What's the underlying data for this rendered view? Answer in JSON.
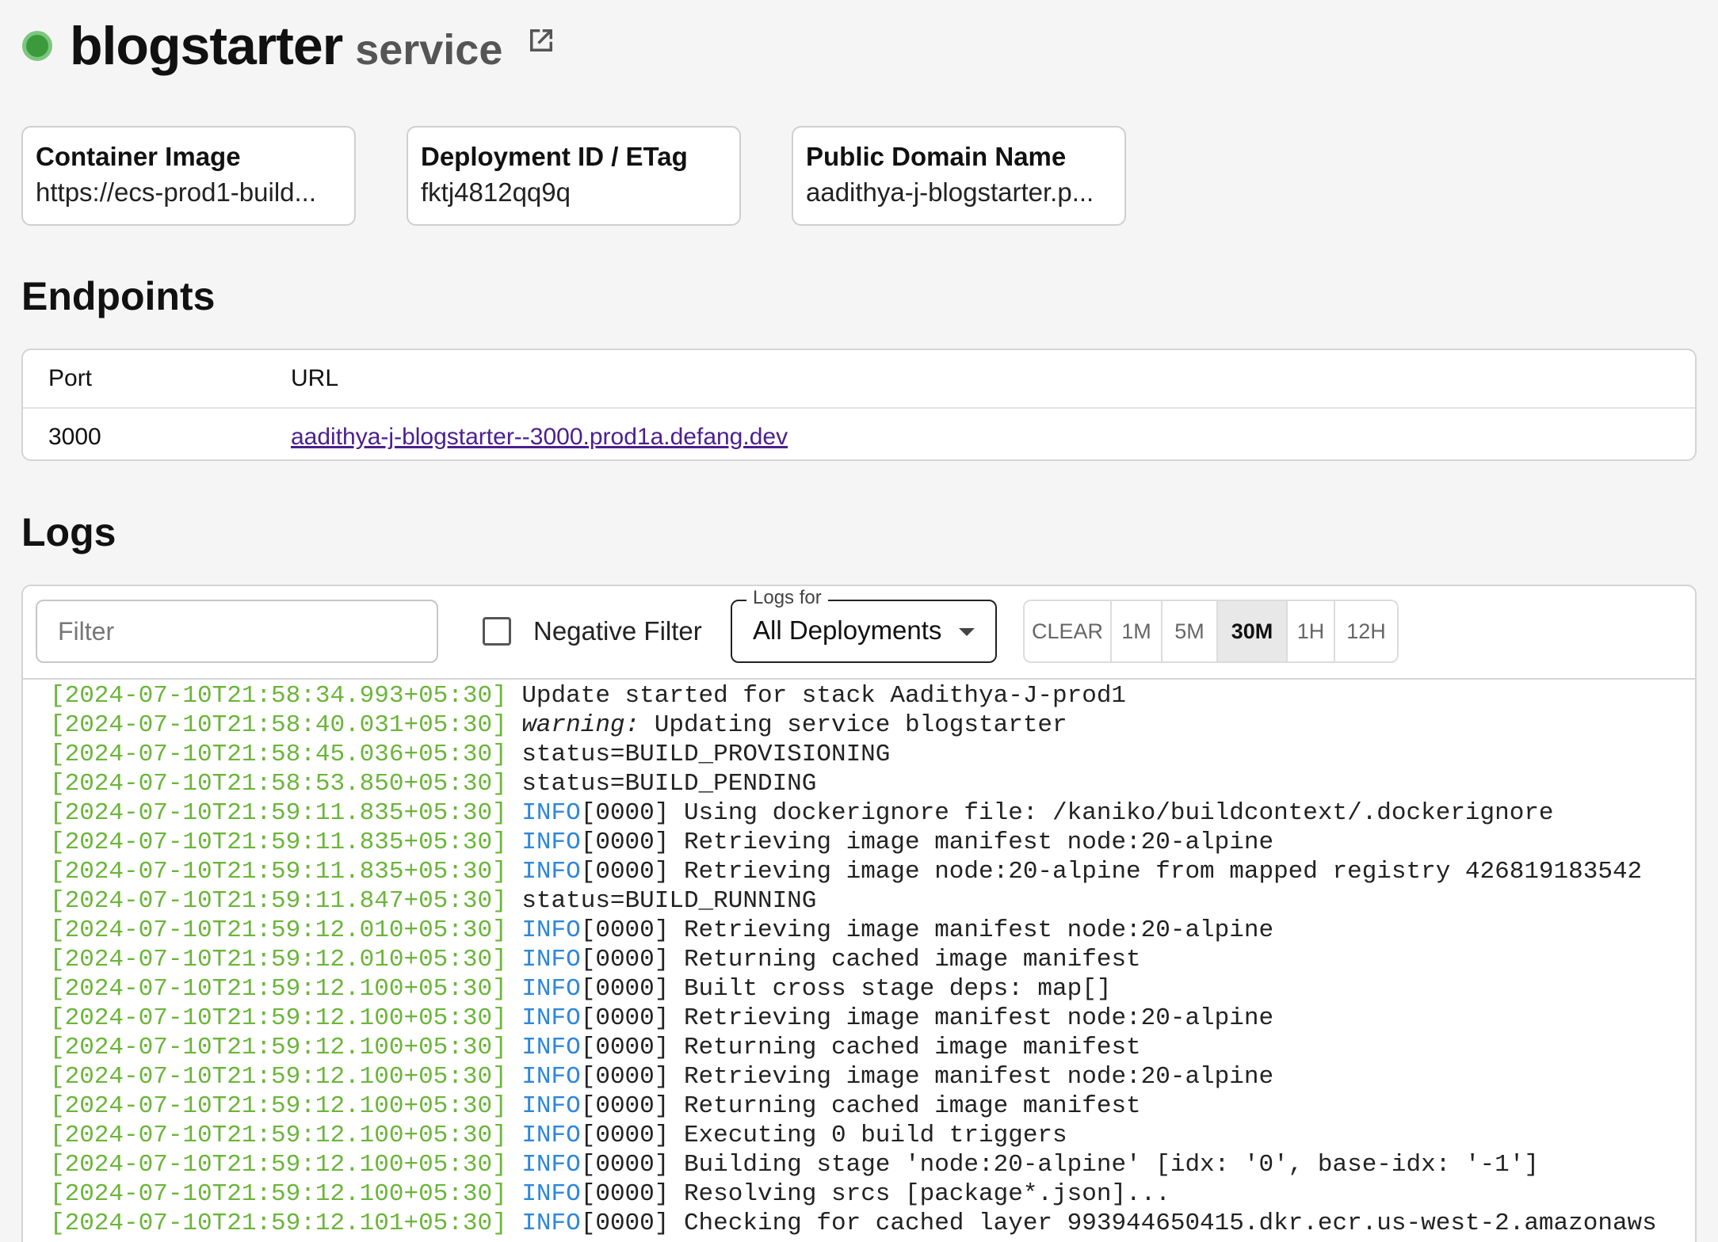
{
  "header": {
    "service_name": "blogstarter",
    "service_suffix": "service",
    "status_color": "#3a9a3c"
  },
  "cards": [
    {
      "title": "Container Image",
      "value": "https://ecs-prod1-build..."
    },
    {
      "title": "Deployment ID / ETag",
      "value": "fktj4812qq9q"
    },
    {
      "title": "Public Domain Name",
      "value": "aadithya-j-blogstarter.p..."
    }
  ],
  "endpoints": {
    "title": "Endpoints",
    "col_port": "Port",
    "col_url": "URL",
    "rows": [
      {
        "port": "3000",
        "url": "aadithya-j-blogstarter--3000.prod1a.defang.dev"
      }
    ]
  },
  "logs": {
    "title": "Logs",
    "filter_placeholder": "Filter",
    "negative_filter_label": "Negative Filter",
    "logs_for_label": "Logs for",
    "logs_for_value": "All Deployments",
    "ranges": [
      "CLEAR",
      "1M",
      "5M",
      "30M",
      "1H",
      "12H"
    ],
    "active_range": "30M",
    "lines": [
      {
        "ts": "[2024-07-10T21:58:34.993+05:30]",
        "level": "",
        "msg": "Update started for stack Aadithya-J-prod1"
      },
      {
        "ts": "[2024-07-10T21:58:40.031+05:30]",
        "level": "",
        "prefix": "warning:",
        "msg": " Updating service blogstarter"
      },
      {
        "ts": "[2024-07-10T21:58:45.036+05:30]",
        "level": "",
        "msg": "status=BUILD_PROVISIONING"
      },
      {
        "ts": "[2024-07-10T21:58:53.850+05:30]",
        "level": "",
        "msg": "status=BUILD_PENDING"
      },
      {
        "ts": "[2024-07-10T21:59:11.835+05:30]",
        "level": "INFO",
        "msg": "[0000] Using dockerignore file: /kaniko/buildcontext/.dockerignore"
      },
      {
        "ts": "[2024-07-10T21:59:11.835+05:30]",
        "level": "INFO",
        "msg": "[0000] Retrieving image manifest node:20-alpine"
      },
      {
        "ts": "[2024-07-10T21:59:11.835+05:30]",
        "level": "INFO",
        "msg": "[0000] Retrieving image node:20-alpine from mapped registry 426819183542"
      },
      {
        "ts": "[2024-07-10T21:59:11.847+05:30]",
        "level": "",
        "msg": "status=BUILD_RUNNING"
      },
      {
        "ts": "[2024-07-10T21:59:12.010+05:30]",
        "level": "INFO",
        "msg": "[0000] Retrieving image manifest node:20-alpine"
      },
      {
        "ts": "[2024-07-10T21:59:12.010+05:30]",
        "level": "INFO",
        "msg": "[0000] Returning cached image manifest"
      },
      {
        "ts": "[2024-07-10T21:59:12.100+05:30]",
        "level": "INFO",
        "msg": "[0000] Built cross stage deps: map[]"
      },
      {
        "ts": "[2024-07-10T21:59:12.100+05:30]",
        "level": "INFO",
        "msg": "[0000] Retrieving image manifest node:20-alpine"
      },
      {
        "ts": "[2024-07-10T21:59:12.100+05:30]",
        "level": "INFO",
        "msg": "[0000] Returning cached image manifest"
      },
      {
        "ts": "[2024-07-10T21:59:12.100+05:30]",
        "level": "INFO",
        "msg": "[0000] Retrieving image manifest node:20-alpine"
      },
      {
        "ts": "[2024-07-10T21:59:12.100+05:30]",
        "level": "INFO",
        "msg": "[0000] Returning cached image manifest"
      },
      {
        "ts": "[2024-07-10T21:59:12.100+05:30]",
        "level": "INFO",
        "msg": "[0000] Executing 0 build triggers"
      },
      {
        "ts": "[2024-07-10T21:59:12.100+05:30]",
        "level": "INFO",
        "msg": "[0000] Building stage 'node:20-alpine' [idx: '0', base-idx: '-1']"
      },
      {
        "ts": "[2024-07-10T21:59:12.100+05:30]",
        "level": "INFO",
        "msg": "[0000] Resolving srcs [package*.json]..."
      },
      {
        "ts": "[2024-07-10T21:59:12.101+05:30]",
        "level": "INFO",
        "msg": "[0000] Checking for cached layer 993944650415.dkr.ecr.us-west-2.amazonaws"
      }
    ]
  }
}
